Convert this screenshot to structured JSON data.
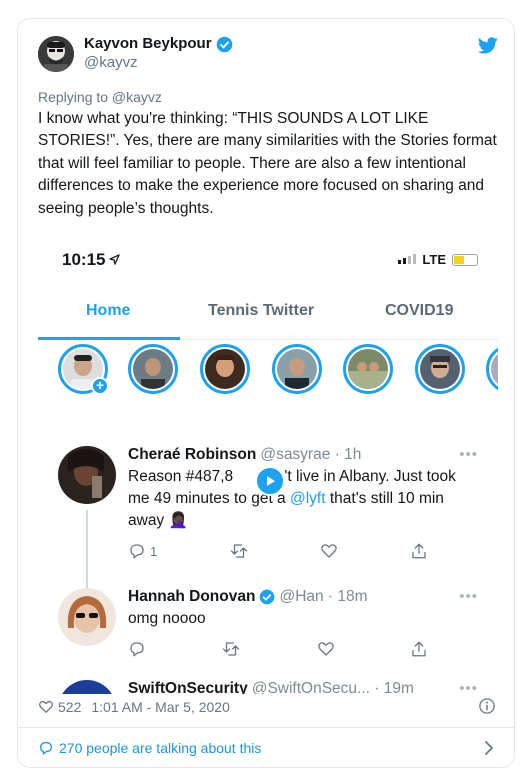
{
  "author": {
    "name": "Kayvon Beykpour",
    "handle": "@kayvz"
  },
  "replying_to": "Replying to @kayvz",
  "body_text": "I know what you're thinking: “THIS SOUNDS A LOT LIKE STORIES!”. Yes, there are many similarities with the Stories format that will feel familiar to people. There are also a few intentional differences to make the experience more focused on sharing and seeing people’s thoughts.",
  "screenshot": {
    "status_time": "10:15",
    "network": "LTE",
    "battery_level": 0.45,
    "tabs": [
      "Home",
      "Tennis Twitter",
      "COVID19"
    ],
    "active_tab": "Home",
    "feed": [
      {
        "name": "Cheraé Robinson",
        "handle": "@sasyrae · 1h",
        "text_before": "Reason #487,8",
        "text_after": "an't live in Albany. Just took me 49 minutes to get a ",
        "link": "@lyft",
        "text_end": " that's still 10 min away 🤦🏿‍♀️",
        "reply_count": "1"
      },
      {
        "name": "Hannah Donovan",
        "handle": "@Han · 18m",
        "text": "omg noooo"
      },
      {
        "name": "SwiftOnSecurity",
        "handle": "@SwiftOnSecu... · 19m"
      }
    ]
  },
  "meta": {
    "likes": "522",
    "timestamp": "1:01 AM - Mar 5, 2020"
  },
  "talking": "270 people are talking about this",
  "colors": {
    "accent": "#1da1f2",
    "muted": "#657786"
  }
}
